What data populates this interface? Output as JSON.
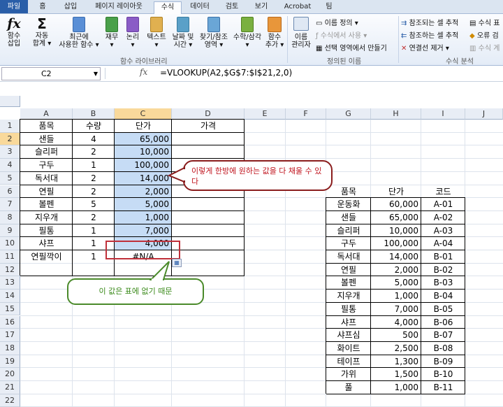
{
  "ribbon_tabs": [
    "파일",
    "홈",
    "삽입",
    "페이지 레이아웃",
    "수식",
    "데이터",
    "검토",
    "보기",
    "Acrobat",
    "팀"
  ],
  "ribbon": {
    "insert_function": "함수\n삽입",
    "autosum": "자동\n합계 ▾",
    "recent": "최근에\n사용한 함수 ▾",
    "financial": "재무\n▾",
    "logical": "논리\n▾",
    "text": "텍스트\n▾",
    "datetime": "날짜 및\n시간 ▾",
    "lookup": "찾기/참조\n영역 ▾",
    "math": "수학/삼각\n▾",
    "more": "함수\n추가 ▾",
    "group_library": "함수 라이브러리",
    "name_manager": "이름\n관리자",
    "define_name": "이름 정의 ▾",
    "use_in_formula": "수식에서 사용 ▾",
    "create_from_selection": "선택 영역에서 만들기",
    "group_names": "정의된 이름",
    "trace_precedents": "참조되는 셀 추적",
    "trace_dependents": "참조하는 셀 추적",
    "remove_arrows": "연결선 제거 ▾",
    "show_formulas": "수식 표",
    "error_check": "오류 검",
    "evaluate": "수식 계",
    "group_audit": "수식 분석"
  },
  "formula_bar": {
    "name_box": "C2",
    "fx": "fx",
    "formula": "=VLOOKUP(A2,$G$7:$I$21,2,0)"
  },
  "columns": [
    "A",
    "B",
    "C",
    "D",
    "E",
    "F",
    "G",
    "H",
    "I",
    "J"
  ],
  "rows": [
    "1",
    "2",
    "3",
    "4",
    "5",
    "6",
    "7",
    "8",
    "9",
    "10",
    "11",
    "12",
    "13",
    "14",
    "15",
    "16",
    "17",
    "18",
    "19",
    "20",
    "21",
    "22"
  ],
  "main_table": {
    "headers": [
      "품목",
      "수량",
      "단가",
      "가격"
    ],
    "rows": [
      [
        "샌들",
        "4",
        "65,000",
        ""
      ],
      [
        "슬리퍼",
        "2",
        "10,000",
        ""
      ],
      [
        "구두",
        "1",
        "100,000",
        ""
      ],
      [
        "독서대",
        "2",
        "14,000",
        ""
      ],
      [
        "연필",
        "2",
        "2,000",
        ""
      ],
      [
        "볼펜",
        "5",
        "5,000",
        ""
      ],
      [
        "지우개",
        "2",
        "1,000",
        ""
      ],
      [
        "필통",
        "1",
        "7,000",
        ""
      ],
      [
        "샤프",
        "1",
        "4,000",
        ""
      ],
      [
        "연필깍이",
        "1",
        "#N/A",
        ""
      ]
    ]
  },
  "lookup_table": {
    "headers": [
      "품목",
      "단가",
      "코드"
    ],
    "rows": [
      [
        "운동화",
        "60,000",
        "A-01"
      ],
      [
        "샌들",
        "65,000",
        "A-02"
      ],
      [
        "슬리퍼",
        "10,000",
        "A-03"
      ],
      [
        "구두",
        "100,000",
        "A-04"
      ],
      [
        "독서대",
        "14,000",
        "B-01"
      ],
      [
        "연필",
        "2,000",
        "B-02"
      ],
      [
        "볼펜",
        "5,000",
        "B-03"
      ],
      [
        "지우개",
        "1,000",
        "B-04"
      ],
      [
        "필통",
        "7,000",
        "B-05"
      ],
      [
        "샤프",
        "4,000",
        "B-06"
      ],
      [
        "샤프심",
        "500",
        "B-07"
      ],
      [
        "화이트",
        "2,500",
        "B-08"
      ],
      [
        "테이프",
        "1,300",
        "B-09"
      ],
      [
        "가위",
        "1,500",
        "B-10"
      ],
      [
        "풀",
        "1,000",
        "B-11"
      ]
    ]
  },
  "callouts": {
    "red": "이렇게 한방에 원하는 값을 다 채울 수 있다",
    "green": "이 값은 표에 없기 때문"
  },
  "colors": {
    "selected_fill": "#c6dcf5",
    "header_highlight": "#f9d99b",
    "callout_red": "#8a1d1d",
    "callout_green": "#4a8a2a"
  }
}
